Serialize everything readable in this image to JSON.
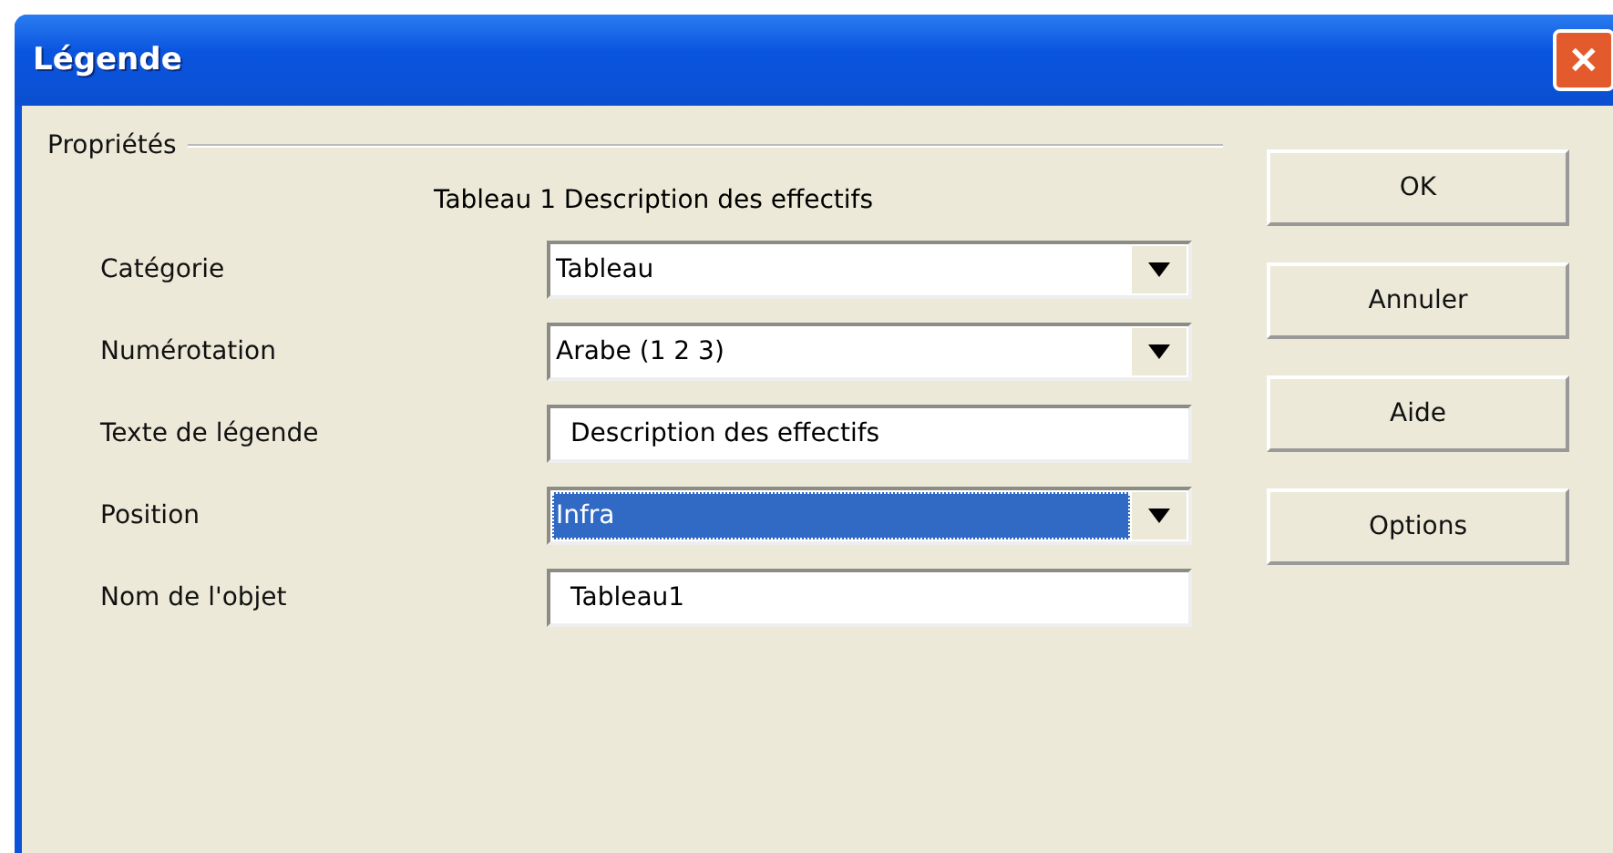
{
  "window": {
    "title": "Légende",
    "close_icon": "✕"
  },
  "group": {
    "title": "Propriétés",
    "preview": "Tableau 1 Description des effectifs"
  },
  "fields": [
    {
      "label": "Catégorie",
      "kind": "dropdown",
      "value": "Tableau",
      "selected": false
    },
    {
      "label": "Numérotation",
      "kind": "dropdown",
      "value": "Arabe (1 2 3)",
      "selected": false
    },
    {
      "label": "Texte de légende",
      "kind": "text",
      "value": "Description des effectifs",
      "selected": false
    },
    {
      "label": "Position",
      "kind": "dropdown",
      "value": "Infra",
      "selected": true
    },
    {
      "label": "Nom de l'objet",
      "kind": "text",
      "value": "Tableau1",
      "selected": false
    }
  ],
  "buttons": [
    {
      "label": "OK"
    },
    {
      "label": "Annuler"
    },
    {
      "label": "Aide"
    },
    {
      "label": "Options"
    }
  ]
}
